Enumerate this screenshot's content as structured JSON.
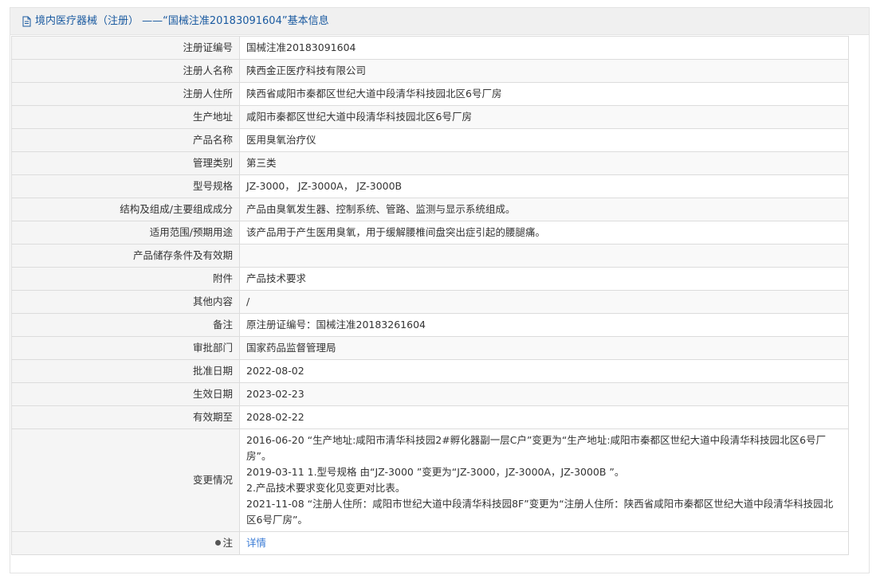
{
  "header": {
    "title": "境内医疗器械（注册） ——“国械注准20183091604”基本信息"
  },
  "rows": [
    {
      "label": "注册证编号",
      "value": "国械注准20183091604"
    },
    {
      "label": "注册人名称",
      "value": "陕西金正医疗科技有限公司"
    },
    {
      "label": "注册人住所",
      "value": "陕西省咸阳市秦都区世纪大道中段清华科技园北区6号厂房"
    },
    {
      "label": "生产地址",
      "value": "咸阳市秦都区世纪大道中段清华科技园北区6号厂房"
    },
    {
      "label": "产品名称",
      "value": "医用臭氧治疗仪"
    },
    {
      "label": "管理类别",
      "value": "第三类"
    },
    {
      "label": "型号规格",
      "value": "JZ-3000， JZ-3000A， JZ-3000B"
    },
    {
      "label": "结构及组成/主要组成成分",
      "value": "产品由臭氧发生器、控制系统、管路、监测与显示系统组成。"
    },
    {
      "label": "适用范围/预期用途",
      "value": "该产品用于产生医用臭氧，用于缓解腰椎间盘突出症引起的腰腿痛。"
    },
    {
      "label": "产品储存条件及有效期",
      "value": ""
    },
    {
      "label": "附件",
      "value": "产品技术要求"
    },
    {
      "label": "其他内容",
      "value": "/"
    },
    {
      "label": "备注",
      "value": "原注册证编号：国械注准20183261604"
    },
    {
      "label": "审批部门",
      "value": "国家药品监督管理局"
    },
    {
      "label": "批准日期",
      "value": "2022-08-02"
    },
    {
      "label": "生效日期",
      "value": "2023-02-23"
    },
    {
      "label": "有效期至",
      "value": "2028-02-22"
    }
  ],
  "changes": {
    "label": "变更情况",
    "lines": [
      "2016-06-20 “生产地址:咸阳市清华科技园2#孵化器副一层C户”变更为“生产地址:咸阳市秦都区世纪大道中段清华科技园北区6号厂房”。",
      "2019-03-11 1.型号规格 由“JZ-3000 ”变更为“JZ-3000，JZ-3000A，JZ-3000B ”。",
      "2.产品技术要求变化见变更对比表。",
      "2021-11-08 “注册人住所：咸阳市世纪大道中段清华科技园8F”变更为“注册人住所：陕西省咸阳市秦都区世纪大道中段清华科技园北区6号厂房”。"
    ]
  },
  "note": {
    "label": "注",
    "link": "详情"
  }
}
